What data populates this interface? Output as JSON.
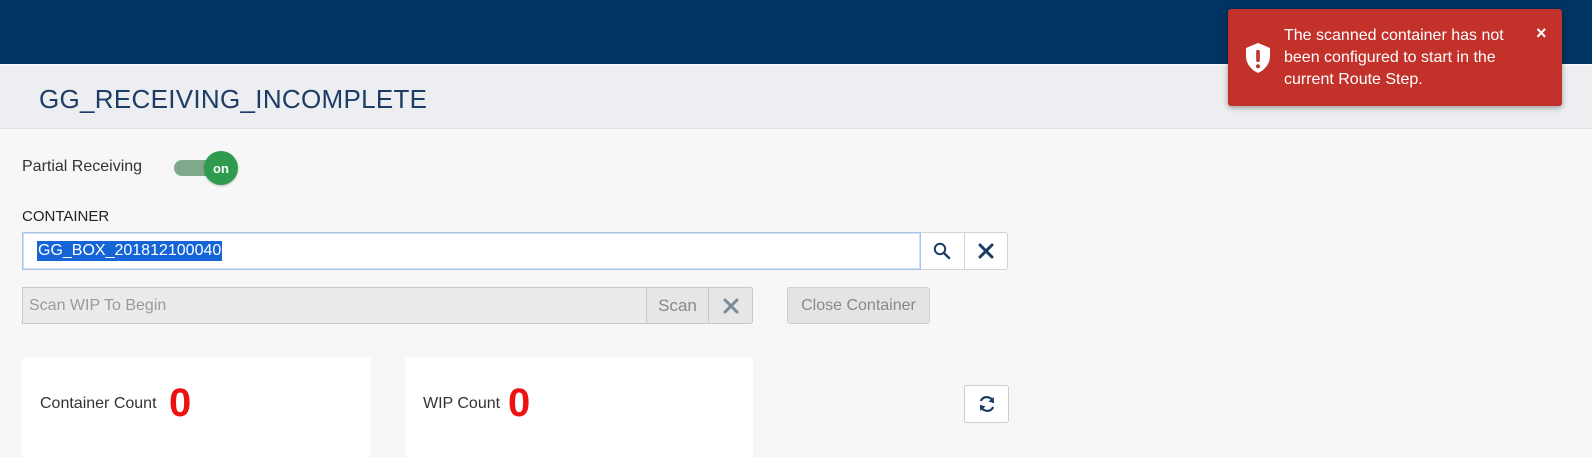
{
  "header": {
    "title": "GG_RECEIVING_INCOMPLETE"
  },
  "partial_receiving": {
    "label": "Partial Receiving",
    "toggle_state": "on"
  },
  "container": {
    "label": "CONTAINER",
    "value": "GG_BOX_201812100040",
    "search_icon": "search-icon",
    "clear_icon": "close-icon"
  },
  "wip": {
    "placeholder": "Scan WIP To Begin",
    "scan_label": "Scan",
    "clear_icon": "close-icon"
  },
  "close_container_label": "Close Container",
  "counts": {
    "container_label": "Container Count",
    "container_value": "0",
    "wip_label": "WIP Count",
    "wip_value": "0"
  },
  "refresh_icon": "refresh-icon",
  "toast": {
    "message": "The scanned container has not been configured to start in the current Route Step.",
    "close_glyph": "×",
    "icon": "shield-alert-icon"
  },
  "colors": {
    "topbar": "#003462",
    "toggle_on": "#2e9b4e",
    "count_value": "#ee1111",
    "toast_bg": "#c2322b",
    "selection": "#1565d8"
  }
}
